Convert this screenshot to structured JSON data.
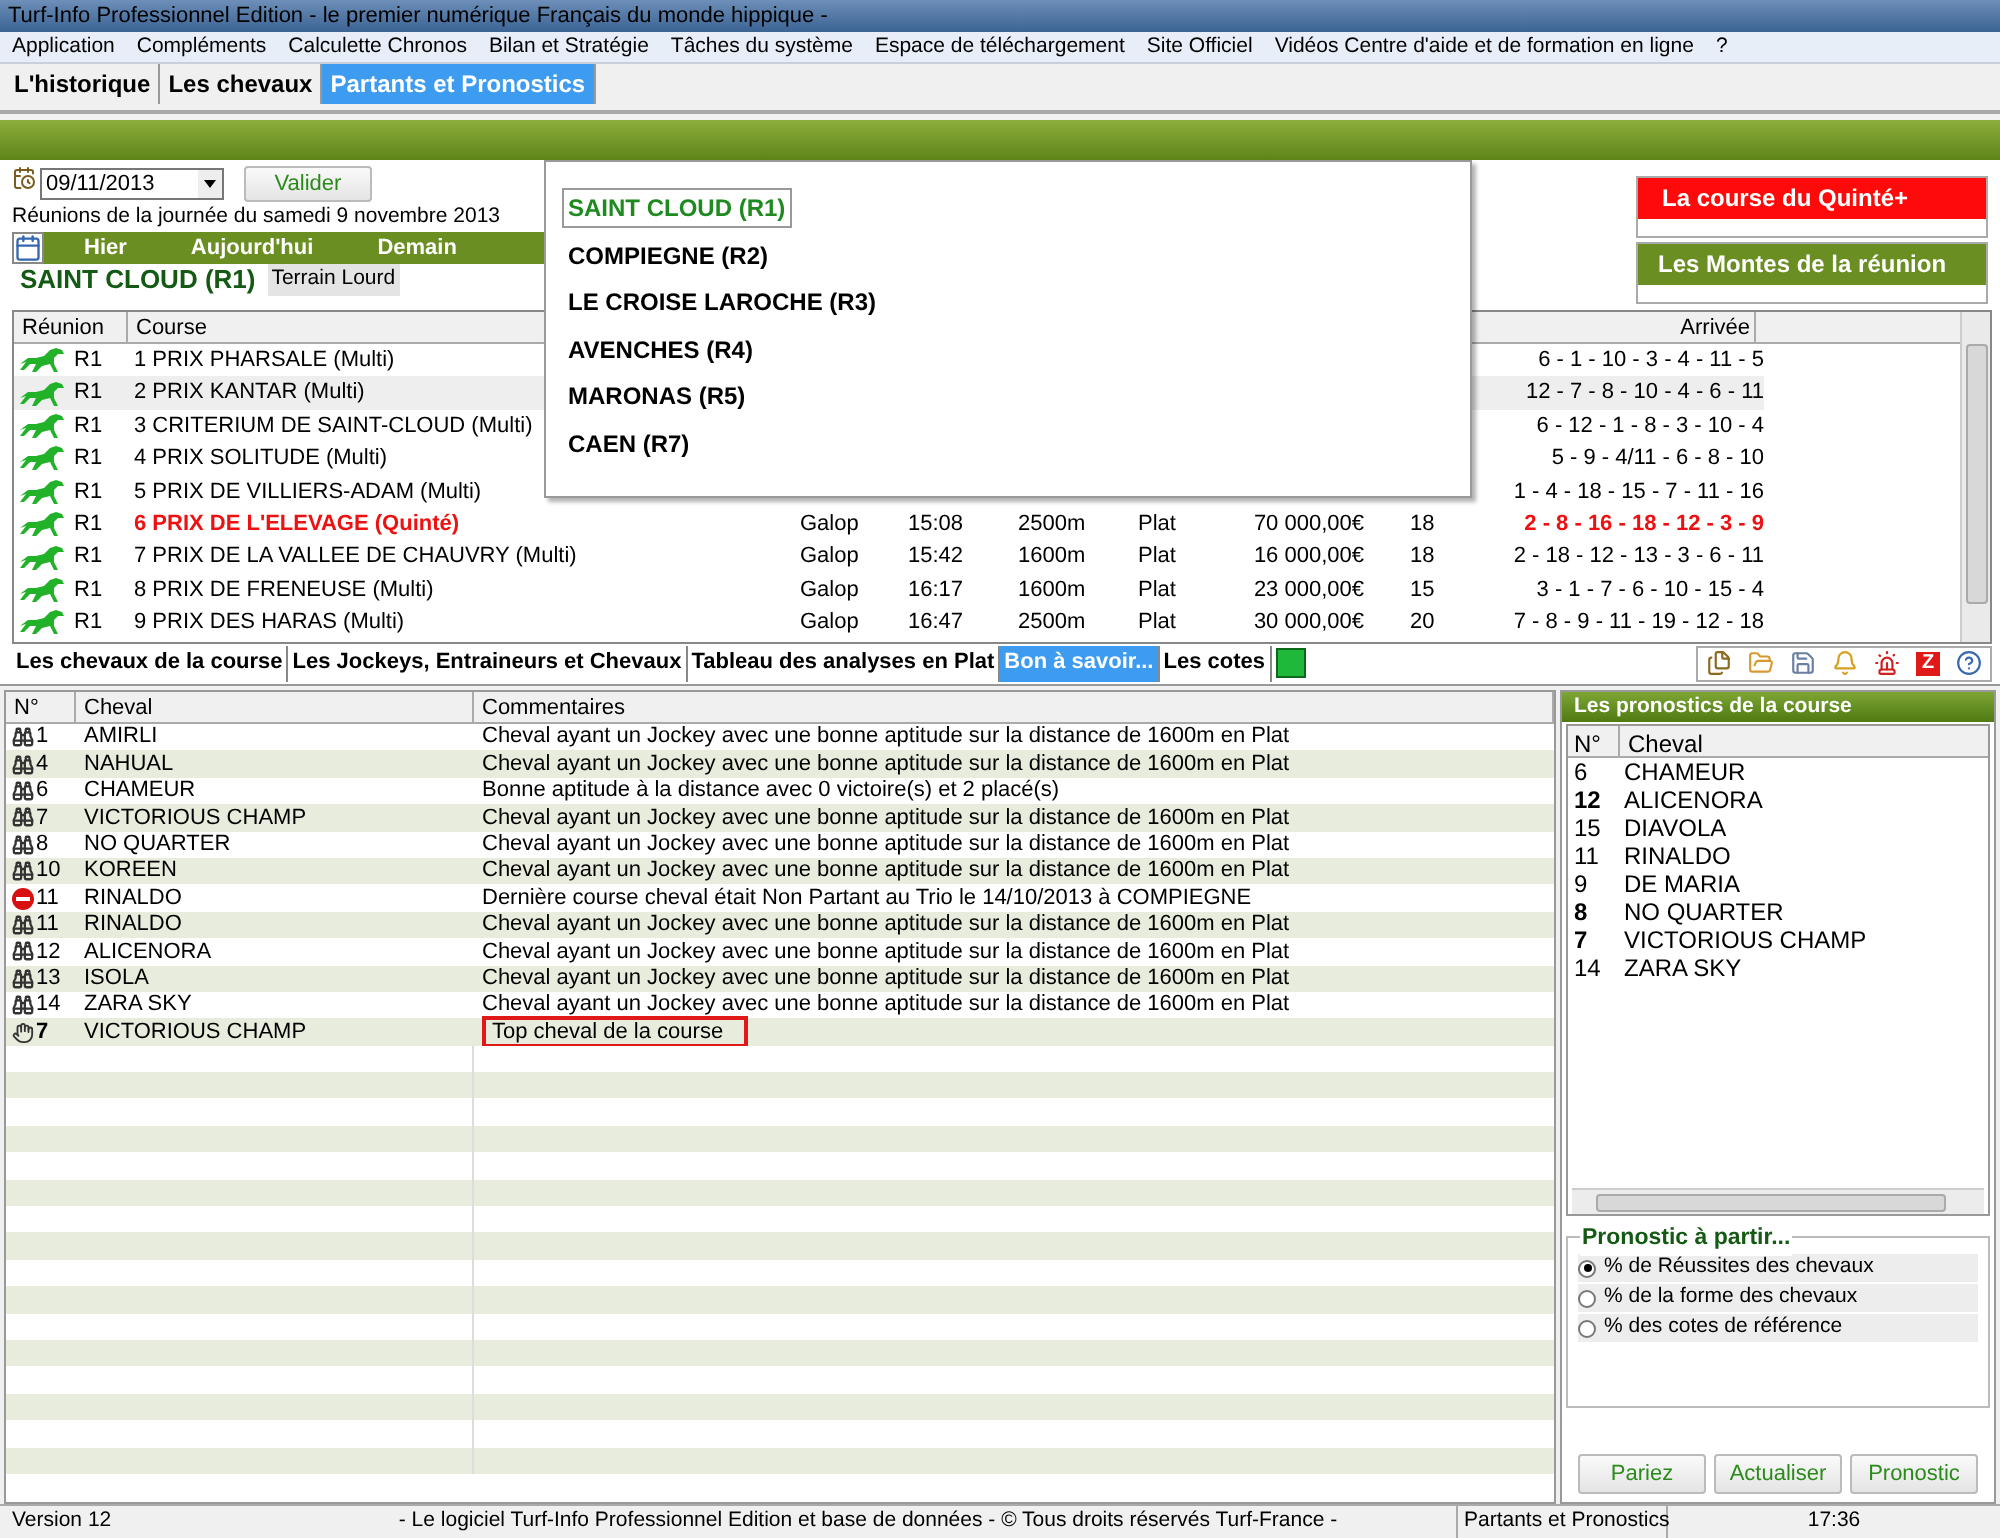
{
  "window": {
    "title": "Turf-Info Professionnel Edition - le premier numérique Français du monde hippique -"
  },
  "menu": [
    "Application",
    "Compléments",
    "Calculette Chronos",
    "Bilan et Stratégie",
    "Tâches du système",
    "Espace de téléchargement",
    "Site Officiel",
    "Vidéos Centre d'aide et de formation en ligne",
    "?"
  ],
  "tabs": [
    {
      "label": "L'historique",
      "selected": false
    },
    {
      "label": "Les chevaux",
      "selected": false
    },
    {
      "label": "Partants et Pronostics",
      "selected": true
    }
  ],
  "date_field": {
    "value": "09/11/2013"
  },
  "validate_button": "Valider",
  "reunions_label": "Réunions de la journée du samedi 9 novembre 2013",
  "day_nav": [
    "Hier",
    "Aujourd'hui",
    "Demain"
  ],
  "meeting": {
    "title": "SAINT CLOUD (R1)",
    "terrain": "Terrain Lourd"
  },
  "meetings_popup": [
    {
      "label": "SAINT CLOUD (R1)",
      "selected": true
    },
    {
      "label": "COMPIEGNE (R2)",
      "selected": false
    },
    {
      "label": "LE CROISE LAROCHE (R3)",
      "selected": false
    },
    {
      "label": "AVENCHES (R4)",
      "selected": false
    },
    {
      "label": "MARONAS (R5)",
      "selected": false
    },
    {
      "label": "CAEN (R7)",
      "selected": false
    }
  ],
  "quinte_button": "La course du Quinté+",
  "montes_button": "Les Montes de la réunion",
  "races": {
    "columns": [
      "Réunion",
      "Course",
      "Arrivée"
    ],
    "rows": [
      {
        "reunion": "R1",
        "course": "1 PRIX PHARSALE (Multi)",
        "cells": [],
        "arrivee": "6 - 1 - 10 - 3 - 4 - 11 - 5",
        "quinte": false,
        "selected": false
      },
      {
        "reunion": "R1",
        "course": "2 PRIX KANTAR (Multi)",
        "cells": [],
        "arrivee": "12 - 7 - 8 - 10 - 4 - 6 - 11",
        "quinte": false,
        "selected": true
      },
      {
        "reunion": "R1",
        "course": "3 CRITERIUM DE SAINT-CLOUD (Multi)",
        "cells": [],
        "arrivee": "6 - 12 - 1 - 8 - 3 - 10 - 4",
        "quinte": false,
        "selected": false
      },
      {
        "reunion": "R1",
        "course": "4 PRIX SOLITUDE (Multi)",
        "cells": [],
        "arrivee": "5 - 9 - 4/11 - 6 - 8 - 10",
        "quinte": false,
        "selected": false
      },
      {
        "reunion": "R1",
        "course": "5 PRIX DE VILLIERS-ADAM (Multi)",
        "cells": [],
        "arrivee": "1 - 4 - 18 - 15 - 7 - 11 - 16",
        "quinte": false,
        "selected": false
      },
      {
        "reunion": "R1",
        "course": "6 PRIX DE L'ELEVAGE (Quinté)",
        "cells": [
          "Galop",
          "15:08",
          "2500m",
          "Plat",
          "70 000,00€",
          "18"
        ],
        "arrivee": "2 - 8 - 16 - 18 - 12 - 3 - 9",
        "quinte": true,
        "selected": false
      },
      {
        "reunion": "R1",
        "course": "7 PRIX DE LA VALLEE DE CHAUVRY (Multi)",
        "cells": [
          "Galop",
          "15:42",
          "1600m",
          "Plat",
          "16 000,00€",
          "18"
        ],
        "arrivee": "2 - 18 - 12 - 13 - 3 - 6 - 11",
        "quinte": false,
        "selected": false
      },
      {
        "reunion": "R1",
        "course": "8 PRIX DE FRENEUSE (Multi)",
        "cells": [
          "Galop",
          "16:17",
          "1600m",
          "Plat",
          "23 000,00€",
          "15"
        ],
        "arrivee": "3 - 1 - 7 - 6 - 10 - 15 - 4",
        "quinte": false,
        "selected": false
      },
      {
        "reunion": "R1",
        "course": "9 PRIX DES HARAS (Multi)",
        "cells": [
          "Galop",
          "16:47",
          "2500m",
          "Plat",
          "30 000,00€",
          "20"
        ],
        "arrivee": "7 - 8 - 9 - 11 - 19 - 12 - 18",
        "quinte": false,
        "selected": false
      }
    ]
  },
  "sub_tabs": [
    {
      "label": "Les chevaux de la course",
      "selected": false
    },
    {
      "label": "Les Jockeys, Entraineurs et Chevaux",
      "selected": false
    },
    {
      "label": "Tableau des analyses en Plat",
      "selected": false
    },
    {
      "label": "Bon à savoir...",
      "selected": true
    },
    {
      "label": "Les cotes",
      "selected": false
    }
  ],
  "toolbar_badge": "Z",
  "comments": {
    "columns": [
      "N°",
      "Cheval",
      "Commentaires"
    ],
    "rows": [
      {
        "kind": "binoculars",
        "number": "1",
        "horse": "AMIRLI",
        "comment": "Cheval ayant un Jockey avec une bonne aptitude sur la distance de 1600m en Plat",
        "highlighted": false
      },
      {
        "kind": "binoculars",
        "number": "4",
        "horse": "NAHUAL",
        "comment": "Cheval ayant un Jockey avec une bonne aptitude sur la distance de 1600m en Plat",
        "highlighted": false
      },
      {
        "kind": "binoculars",
        "number": "6",
        "horse": "CHAMEUR",
        "comment": "Bonne aptitude à la distance avec  0 victoire(s) et 2 placé(s)",
        "highlighted": false
      },
      {
        "kind": "binoculars",
        "number": "7",
        "horse": "VICTORIOUS CHAMP",
        "comment": "Cheval ayant un Jockey avec une bonne aptitude sur la distance de 1600m en Plat",
        "highlighted": false
      },
      {
        "kind": "binoculars",
        "number": "8",
        "horse": "NO QUARTER",
        "comment": "Cheval ayant un Jockey avec une bonne aptitude sur la distance de 1600m en Plat",
        "highlighted": false
      },
      {
        "kind": "binoculars",
        "number": "10",
        "horse": "KOREEN",
        "comment": "Cheval ayant un Jockey avec une bonne aptitude sur la distance de 1600m en Plat",
        "highlighted": false
      },
      {
        "kind": "stop",
        "number": "11",
        "horse": "RINALDO",
        "comment": "Dernière course cheval était Non Partant au Trio le 14/10/2013 à COMPIEGNE",
        "highlighted": false
      },
      {
        "kind": "binoculars",
        "number": "11",
        "horse": "RINALDO",
        "comment": "Cheval ayant un Jockey avec une bonne aptitude sur la distance de 1600m en Plat",
        "highlighted": false
      },
      {
        "kind": "binoculars",
        "number": "12",
        "horse": "ALICENORA",
        "comment": "Cheval ayant un Jockey avec une bonne aptitude sur la distance de 1600m en Plat",
        "highlighted": false
      },
      {
        "kind": "binoculars",
        "number": "13",
        "horse": "ISOLA",
        "comment": "Cheval ayant un Jockey avec une bonne aptitude sur la distance de 1600m en Plat",
        "highlighted": false
      },
      {
        "kind": "binoculars",
        "number": "14",
        "horse": "ZARA SKY",
        "comment": "Cheval ayant un Jockey avec une bonne aptitude sur la distance de 1600m en Plat",
        "highlighted": false
      },
      {
        "kind": "hand",
        "number": "7",
        "horse": "VICTORIOUS CHAMP",
        "comment": "Top cheval de la course",
        "highlighted": true
      }
    ]
  },
  "pronostics": {
    "title": "Les pronostics de la course",
    "columns": [
      "N°",
      "Cheval"
    ],
    "rows": [
      {
        "number": "6",
        "horse": "CHAMEUR",
        "emphasized": false
      },
      {
        "number": "12",
        "horse": "ALICENORA",
        "emphasized": true
      },
      {
        "number": "15",
        "horse": "DIAVOLA",
        "emphasized": false
      },
      {
        "number": "11",
        "horse": "RINALDO",
        "emphasized": false
      },
      {
        "number": "9",
        "horse": "DE MARIA",
        "emphasized": false
      },
      {
        "number": "8",
        "horse": "NO QUARTER",
        "emphasized": true
      },
      {
        "number": "7",
        "horse": "VICTORIOUS CHAMP",
        "emphasized": true
      },
      {
        "number": "14",
        "horse": "ZARA SKY",
        "emphasized": false
      }
    ]
  },
  "pronostic_source": {
    "title": "Pronostic à partir...",
    "options": [
      {
        "label": "% de Réussites des chevaux",
        "selected": true
      },
      {
        "label": "% de la forme des chevaux",
        "selected": false
      },
      {
        "label": "% des cotes de référence",
        "selected": false
      }
    ]
  },
  "buttons": [
    "Pariez",
    "Actualiser",
    "Pronostic"
  ],
  "status_bar": [
    "Version 12",
    "- Le logiciel Turf-Info Professionnel Edition et base de données - © Tous droits réservés Turf-France -",
    "Partants et Pronostics",
    "17:36"
  ]
}
